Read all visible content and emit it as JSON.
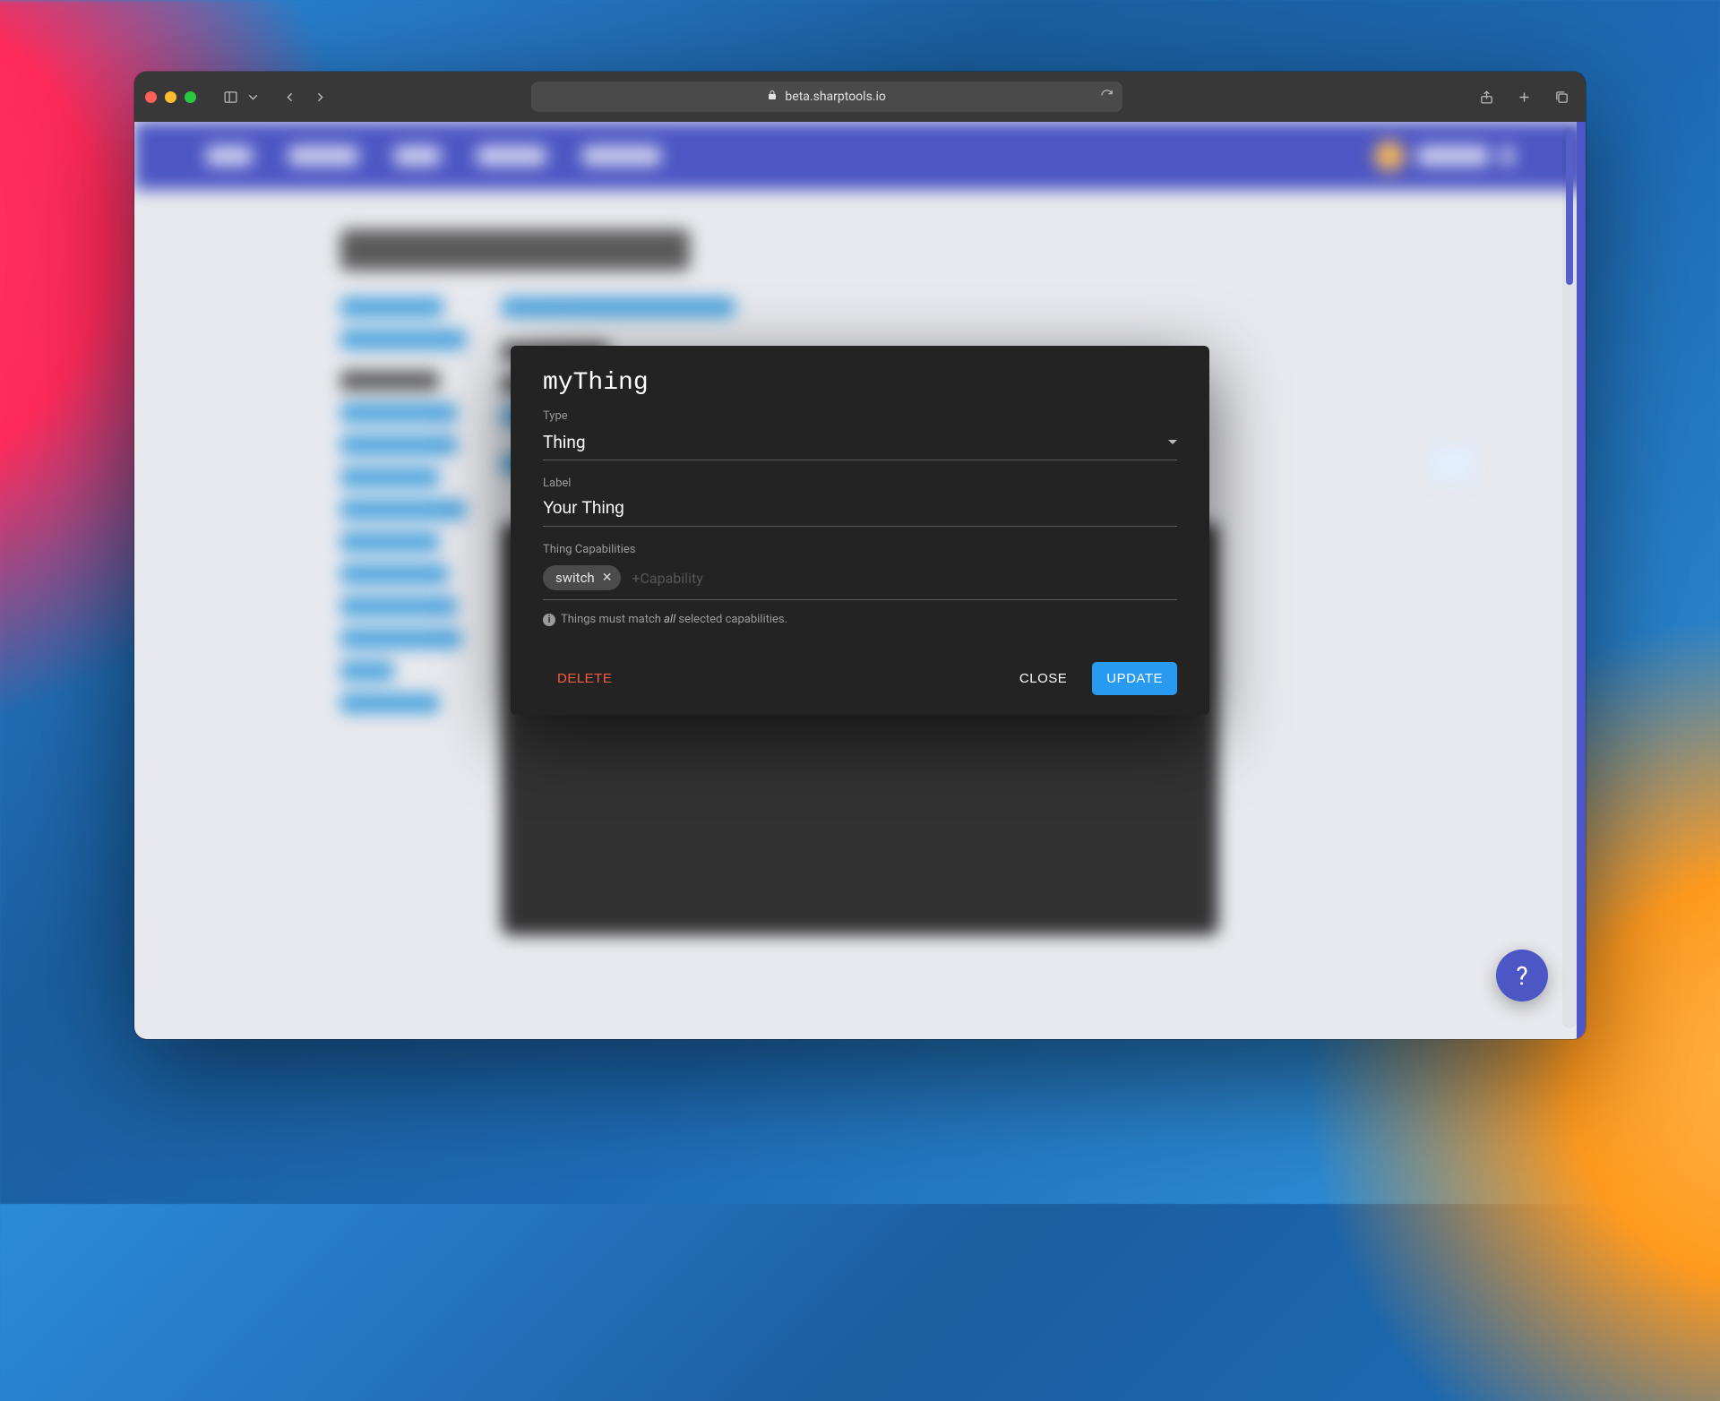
{
  "browser": {
    "url": "beta.sharptools.io"
  },
  "modal": {
    "title": "myThing",
    "type": {
      "label": "Type",
      "value": "Thing"
    },
    "label": {
      "label": "Label",
      "value": "Your Thing"
    },
    "capabilities": {
      "label": "Thing Capabilities",
      "chips": [
        "switch"
      ],
      "placeholder": "+Capability"
    },
    "hint_pre": "Things must match",
    "hint_em": "all",
    "hint_post": "selected capabilities.",
    "buttons": {
      "delete": "Delete",
      "close": "Close",
      "update": "Update"
    }
  },
  "help_fab": "?"
}
